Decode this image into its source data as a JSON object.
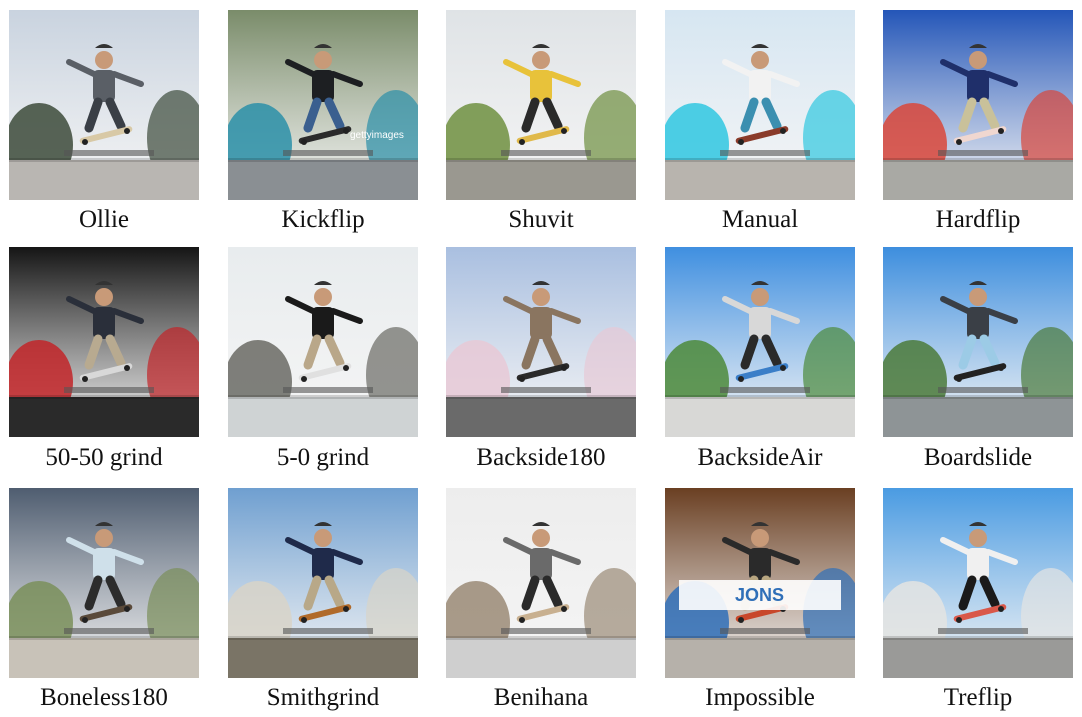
{
  "tiles": [
    {
      "label": "Ollie",
      "sky": "#c9d3df",
      "ground": "#b9b6b2",
      "accent": "#3c4a3a",
      "shirt": "#5a5f66",
      "pants": "#3a3f46",
      "board": "#d8c9a6"
    },
    {
      "label": "Kickflip",
      "sky": "#7a8c6a",
      "ground": "#8a8f93",
      "accent": "#2a8fa8",
      "shirt": "#1d1f22",
      "pants": "#3a5f8f",
      "board": "#2b2b2b",
      "watermark": "gettyimages"
    },
    {
      "label": "Shuvit",
      "sky": "#dfe3e6",
      "ground": "#9a9890",
      "accent": "#6e8f3f",
      "shirt": "#e8c23a",
      "pants": "#2a2a2a",
      "board": "#e0b94a"
    },
    {
      "label": "Manual",
      "sky": "#d6e6f2",
      "ground": "#b8b4ae",
      "accent": "#2fc7e0",
      "shirt": "#f2f2f2",
      "pants": "#3b8fb0",
      "board": "#8a3b2a"
    },
    {
      "label": "Hardflip",
      "sky": "#2456b8",
      "ground": "#a9a9a4",
      "accent": "#d9463a",
      "shirt": "#1f2f6a",
      "pants": "#c9c19a",
      "board": "#f0d7d0"
    },
    {
      "label": "50-50 grind",
      "sky": "#151515",
      "ground": "#2a2a2a",
      "accent": "#c22428",
      "shirt": "#2a2f3a",
      "pants": "#b8aa90",
      "board": "#d8d8d8"
    },
    {
      "label": "5-0 grind",
      "sky": "#e8ecee",
      "ground": "#cfd3d4",
      "accent": "#6a6a64",
      "shirt": "#1a1a1a",
      "pants": "#b9a789",
      "board": "#e0e0e0"
    },
    {
      "label": "Backside180",
      "sky": "#a9bfe0",
      "ground": "#6a6a6a",
      "accent": "#e7c9d6",
      "shirt": "#8a7560",
      "pants": "#8a7560",
      "board": "#2a2a2a"
    },
    {
      "label": "BacksideAir",
      "sky": "#3f8fe0",
      "ground": "#d8d8d6",
      "accent": "#4c8a3a",
      "shirt": "#d8d8d8",
      "pants": "#2a2a2a",
      "board": "#3a7ec8"
    },
    {
      "label": "Boardslide",
      "sky": "#3d8ede",
      "ground": "#8e9496",
      "accent": "#4b7a3a",
      "shirt": "#3a3f46",
      "pants": "#9ccbe6",
      "board": "#222222"
    },
    {
      "label": "Boneless180",
      "sky": "#4f5d70",
      "ground": "#c8c2b8",
      "accent": "#7a8f5a",
      "shirt": "#cfe0ea",
      "pants": "#2c2c2c",
      "board": "#5a4a3a"
    },
    {
      "label": "Smithgrind",
      "sky": "#6f9fd0",
      "ground": "#7a7466",
      "accent": "#d8d4c8",
      "shirt": "#1f2a4a",
      "pants": "#b8a888",
      "board": "#b06a2a"
    },
    {
      "label": "Benihana",
      "sky": "#ededed",
      "ground": "#cfcfcf",
      "accent": "#9a8a76",
      "shirt": "#6a6a6a",
      "pants": "#2a2a2a",
      "board": "#c8b090"
    },
    {
      "label": "Impossible",
      "sky": "#6a3f22",
      "ground": "#b6b1aa",
      "accent": "#2f6fb8",
      "shirt": "#2a2a2a",
      "pants": "#b8a680",
      "board": "#c8472a",
      "sign": "JONS"
    },
    {
      "label": "Treflip",
      "sky": "#4a9be2",
      "ground": "#9a9a98",
      "accent": "#e4e4e2",
      "shirt": "#f0f0f0",
      "pants": "#1a1a1a",
      "board": "#d9584a"
    }
  ]
}
